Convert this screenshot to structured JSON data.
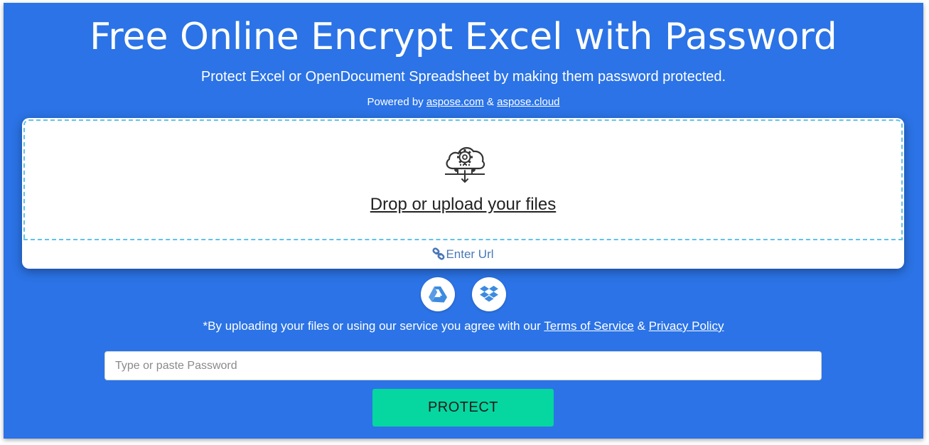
{
  "header": {
    "title": "Free Online Encrypt Excel with Password",
    "subtitle": "Protect Excel or OpenDocument Spreadsheet by making them password protected.",
    "powered_prefix": "Powered by",
    "powered_link1": "aspose.com",
    "powered_amp": "&",
    "powered_link2": "aspose.cloud"
  },
  "upload": {
    "drop_label": "Drop or upload your files",
    "enter_url_label": "Enter Url",
    "icon": "cloud-gear-icon"
  },
  "cloud_sources": [
    {
      "name": "google-drive",
      "icon": "google-drive-icon"
    },
    {
      "name": "dropbox",
      "icon": "dropbox-icon"
    }
  ],
  "terms": {
    "prefix": "*By uploading your files or using our service you agree with our",
    "terms_link": "Terms of Service",
    "amp": "&",
    "privacy_link": "Privacy Policy"
  },
  "password": {
    "value": "",
    "placeholder": "Type or paste Password"
  },
  "actions": {
    "protect_label": "PROTECT"
  },
  "colors": {
    "background": "#2b73e6",
    "accent_button": "#06d6a0",
    "dashed_border": "#5ec3ea",
    "url_link": "#4a78b8"
  }
}
